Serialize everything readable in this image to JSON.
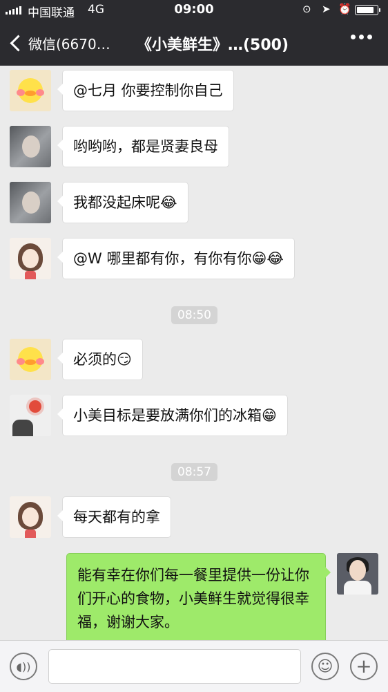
{
  "status_bar": {
    "carrier": "中国联通",
    "network": "4G",
    "time": "09:00"
  },
  "nav": {
    "back_label": "微信(6670…",
    "title": "《小美鲜生》…(500)"
  },
  "messages": [
    {
      "text": "@七月 你要控制你自己",
      "emoji": ""
    },
    {
      "text": "哟哟哟，都是贤妻良母",
      "emoji": ""
    },
    {
      "text": "我都没起床呢",
      "emoji": "😂"
    },
    {
      "text": "@W 哪里都有你，有你有你",
      "emoji": "😁😂"
    },
    {
      "text": "必须的",
      "emoji": "😏"
    },
    {
      "text": "小美目标是要放满你们的冰箱",
      "emoji": "😁"
    },
    {
      "text": "每天都有的拿",
      "emoji": ""
    }
  ],
  "timestamps": [
    "08:50",
    "08:57"
  ],
  "my_message": "能有幸在你们每一餐里提供一份让你们开心的食物，小美鲜生就觉得很幸福，谢谢大家。",
  "icons": {
    "voice": "voice-toggle-icon",
    "emoji": "emoji-icon",
    "plus": "plus-icon"
  },
  "colors": {
    "nav_bg": "#2b2b2f",
    "chat_bg": "#ebebeb",
    "my_bubble": "#9eea6a",
    "their_bubble": "#ffffff"
  }
}
